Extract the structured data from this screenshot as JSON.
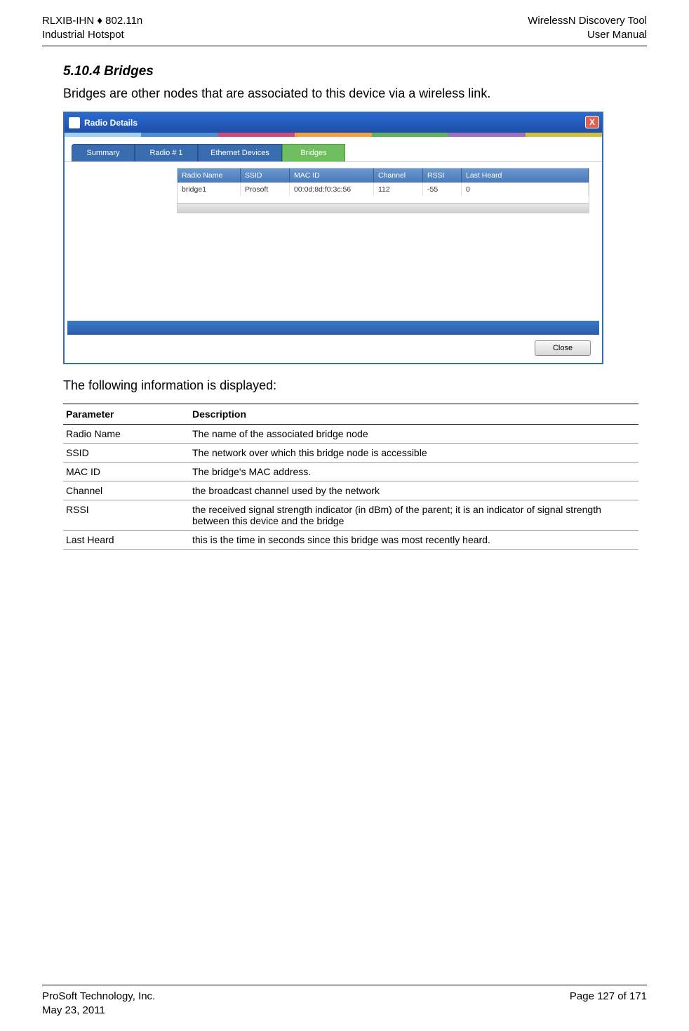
{
  "header": {
    "left1": "RLXIB-IHN ♦ 802.11n",
    "left2": "Industrial Hotspot",
    "right1": "WirelessN Discovery Tool",
    "right2": "User Manual"
  },
  "section": {
    "number_title": "5.10.4 Bridges",
    "intro": "Bridges are other nodes that are associated to this device via a wireless link.",
    "followup": "The following information is displayed:"
  },
  "dialog": {
    "title": "Radio Details",
    "close_x": "X",
    "tabs": {
      "summary": "Summary",
      "radio1": "Radio # 1",
      "ethernet": "Ethernet Devices",
      "bridges": "Bridges"
    },
    "grid_headers": {
      "radio_name": "Radio Name",
      "ssid": "SSID",
      "mac_id": "MAC ID",
      "channel": "Channel",
      "rssi": "RSSI",
      "last_heard": "Last Heard"
    },
    "grid_row": {
      "radio_name": "bridge1",
      "ssid": "Prosoft",
      "mac_id": "00:0d:8d:f0:3c:56",
      "channel": "112",
      "rssi": "-55",
      "last_heard": "0"
    },
    "close_button": "Close"
  },
  "table": {
    "head_param": "Parameter",
    "head_desc": "Description",
    "rows": [
      {
        "p": "Radio Name",
        "d": "The name of the associated bridge node"
      },
      {
        "p": "SSID",
        "d": "The network over which this bridge node is accessible"
      },
      {
        "p": "MAC ID",
        "d": "The bridge's MAC address."
      },
      {
        "p": "Channel",
        "d": "the broadcast channel used by the network"
      },
      {
        "p": "RSSI",
        "d": "the received signal strength indicator (in dBm) of the parent; it is an indicator of signal strength between this device and the bridge"
      },
      {
        "p": "Last Heard",
        "d": "this is the time in seconds since this bridge was most recently heard."
      }
    ]
  },
  "footer": {
    "left1": "ProSoft Technology, Inc.",
    "left2": "May 23, 2011",
    "right1": "Page 127 of 171"
  }
}
